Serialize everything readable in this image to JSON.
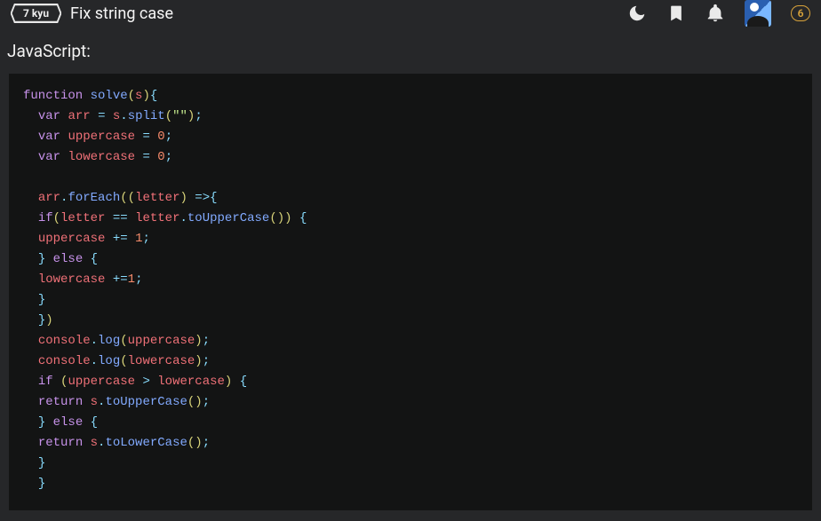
{
  "header": {
    "kyu_label": "7 kyu",
    "title": "Fix string case",
    "honor": "6"
  },
  "language_label": "JavaScript:",
  "icons": {
    "theme": "moon-icon",
    "bookmark": "bookmark-icon",
    "notifications": "bell-icon"
  },
  "code": {
    "lines": [
      [
        [
          "kw",
          "function"
        ],
        [
          "def",
          " "
        ],
        [
          "fn",
          "solve"
        ],
        [
          "par",
          "("
        ],
        [
          "id",
          "s"
        ],
        [
          "par",
          ")"
        ],
        [
          "op",
          "{"
        ]
      ],
      [
        [
          "def",
          "  "
        ],
        [
          "kw",
          "var"
        ],
        [
          "def",
          " "
        ],
        [
          "id",
          "arr"
        ],
        [
          "def",
          " "
        ],
        [
          "op",
          "="
        ],
        [
          "def",
          " "
        ],
        [
          "id",
          "s"
        ],
        [
          "op",
          "."
        ],
        [
          "fn",
          "split"
        ],
        [
          "par",
          "("
        ],
        [
          "str",
          "\"\""
        ],
        [
          "par",
          ")"
        ],
        [
          "op",
          ";"
        ]
      ],
      [
        [
          "def",
          "  "
        ],
        [
          "kw",
          "var"
        ],
        [
          "def",
          " "
        ],
        [
          "id",
          "uppercase"
        ],
        [
          "def",
          " "
        ],
        [
          "op",
          "="
        ],
        [
          "def",
          " "
        ],
        [
          "num",
          "0"
        ],
        [
          "op",
          ";"
        ]
      ],
      [
        [
          "def",
          "  "
        ],
        [
          "kw",
          "var"
        ],
        [
          "def",
          " "
        ],
        [
          "id",
          "lowercase"
        ],
        [
          "def",
          " "
        ],
        [
          "op",
          "="
        ],
        [
          "def",
          " "
        ],
        [
          "num",
          "0"
        ],
        [
          "op",
          ";"
        ]
      ],
      [
        [
          "def",
          "  "
        ]
      ],
      [
        [
          "def",
          "  "
        ],
        [
          "id",
          "arr"
        ],
        [
          "op",
          "."
        ],
        [
          "fn",
          "forEach"
        ],
        [
          "par",
          "(("
        ],
        [
          "id",
          "letter"
        ],
        [
          "par",
          ")"
        ],
        [
          "def",
          " "
        ],
        [
          "op",
          "=>"
        ],
        [
          "op",
          "{"
        ]
      ],
      [
        [
          "def",
          "  "
        ],
        [
          "kw",
          "if"
        ],
        [
          "par",
          "("
        ],
        [
          "id",
          "letter"
        ],
        [
          "def",
          " "
        ],
        [
          "op",
          "=="
        ],
        [
          "def",
          " "
        ],
        [
          "id",
          "letter"
        ],
        [
          "op",
          "."
        ],
        [
          "fn",
          "toUpperCase"
        ],
        [
          "par",
          "()"
        ],
        [
          "par",
          ")"
        ],
        [
          "def",
          " "
        ],
        [
          "op",
          "{"
        ]
      ],
      [
        [
          "def",
          "  "
        ],
        [
          "id",
          "uppercase"
        ],
        [
          "def",
          " "
        ],
        [
          "op",
          "+="
        ],
        [
          "def",
          " "
        ],
        [
          "num",
          "1"
        ],
        [
          "op",
          ";"
        ]
      ],
      [
        [
          "def",
          "  "
        ],
        [
          "op",
          "}"
        ],
        [
          "def",
          " "
        ],
        [
          "kw",
          "else"
        ],
        [
          "def",
          " "
        ],
        [
          "op",
          "{"
        ]
      ],
      [
        [
          "def",
          "  "
        ],
        [
          "id",
          "lowercase"
        ],
        [
          "def",
          " "
        ],
        [
          "op",
          "+="
        ],
        [
          "num",
          "1"
        ],
        [
          "op",
          ";"
        ]
      ],
      [
        [
          "def",
          "  "
        ],
        [
          "op",
          "}"
        ]
      ],
      [
        [
          "def",
          "  "
        ],
        [
          "op",
          "}"
        ],
        [
          "par",
          ")"
        ]
      ],
      [
        [
          "def",
          "  "
        ],
        [
          "id",
          "console"
        ],
        [
          "op",
          "."
        ],
        [
          "fn",
          "log"
        ],
        [
          "par",
          "("
        ],
        [
          "id",
          "uppercase"
        ],
        [
          "par",
          ")"
        ],
        [
          "op",
          ";"
        ]
      ],
      [
        [
          "def",
          "  "
        ],
        [
          "id",
          "console"
        ],
        [
          "op",
          "."
        ],
        [
          "fn",
          "log"
        ],
        [
          "par",
          "("
        ],
        [
          "id",
          "lowercase"
        ],
        [
          "par",
          ")"
        ],
        [
          "op",
          ";"
        ]
      ],
      [
        [
          "def",
          "  "
        ],
        [
          "kw",
          "if"
        ],
        [
          "def",
          " "
        ],
        [
          "par",
          "("
        ],
        [
          "id",
          "uppercase"
        ],
        [
          "def",
          " "
        ],
        [
          "op",
          ">"
        ],
        [
          "def",
          " "
        ],
        [
          "id",
          "lowercase"
        ],
        [
          "par",
          ")"
        ],
        [
          "def",
          " "
        ],
        [
          "op",
          "{"
        ]
      ],
      [
        [
          "def",
          "  "
        ],
        [
          "kw",
          "return"
        ],
        [
          "def",
          " "
        ],
        [
          "id",
          "s"
        ],
        [
          "op",
          "."
        ],
        [
          "fn",
          "toUpperCase"
        ],
        [
          "par",
          "()"
        ],
        [
          "op",
          ";"
        ]
      ],
      [
        [
          "def",
          "  "
        ],
        [
          "op",
          "}"
        ],
        [
          "def",
          " "
        ],
        [
          "kw",
          "else"
        ],
        [
          "def",
          " "
        ],
        [
          "op",
          "{"
        ]
      ],
      [
        [
          "def",
          "  "
        ],
        [
          "kw",
          "return"
        ],
        [
          "def",
          " "
        ],
        [
          "id",
          "s"
        ],
        [
          "op",
          "."
        ],
        [
          "fn",
          "toLowerCase"
        ],
        [
          "par",
          "()"
        ],
        [
          "op",
          ";"
        ]
      ],
      [
        [
          "def",
          "  "
        ],
        [
          "op",
          "}"
        ]
      ],
      [
        [
          "def",
          "  "
        ],
        [
          "op",
          "}"
        ]
      ]
    ]
  }
}
